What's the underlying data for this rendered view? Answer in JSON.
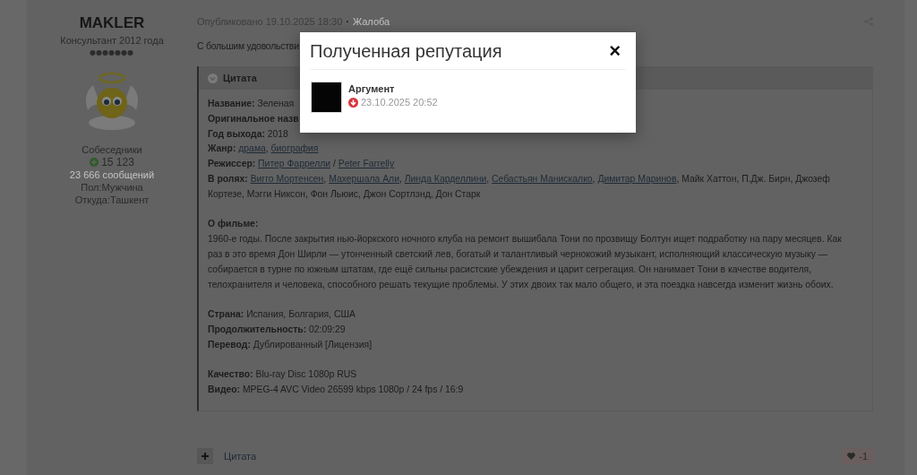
{
  "author": {
    "name": "MAKLER",
    "rank": "Консультант 2012 года",
    "group": "Собеседники",
    "reputation": "15 123",
    "posts": "23 666 сообщений",
    "gender": "Пол:Мужчина",
    "location": "Откуда:Ташкент"
  },
  "post": {
    "published": "Опубликовано 19.10.2025 18:30",
    "separator": "·",
    "report": "Жалоба",
    "intro": "С большим удовольстви",
    "quote": {
      "title": "Цитата",
      "sections": [
        [
          {
            "label": "Название:",
            "parts": [
              {
                "text": "Зеленая",
                "link": false
              }
            ]
          },
          {
            "label": "Оригинальное назв"
          },
          {
            "label": "Год выхода:",
            "parts": [
              {
                "text": "2018",
                "link": false
              }
            ]
          },
          {
            "label": "Жанр:",
            "parts": [
              {
                "text": "драма",
                "link": true
              },
              {
                "text": ", ",
                "link": false
              },
              {
                "text": "биография",
                "link": true
              }
            ]
          },
          {
            "label": "Режиссер:",
            "parts": [
              {
                "text": "Питер Фаррелли",
                "link": true
              },
              {
                "text": " / ",
                "link": false
              },
              {
                "text": "Peter Farrelly",
                "link": true
              }
            ]
          },
          {
            "label": "В ролях:",
            "parts": [
              {
                "text": "Вигго Мортенсен",
                "link": true
              },
              {
                "text": ", ",
                "link": false
              },
              {
                "text": "Махершала Али",
                "link": true
              },
              {
                "text": ", ",
                "link": false
              },
              {
                "text": "Линда Карделлини",
                "link": true
              },
              {
                "text": ", ",
                "link": false
              },
              {
                "text": "Себастьян Манискалко",
                "link": true
              },
              {
                "text": ", ",
                "link": false
              },
              {
                "text": "Димитар Маринов",
                "link": true
              },
              {
                "text": ", Майк Хаттон, П.Дж. Бирн, Джозеф Кортезе, Мэгги Никсон, Фон Льюис, Джон Сортлэнд, Дон Старк",
                "link": false
              }
            ]
          }
        ],
        [
          {
            "label": "О фильме:"
          },
          {
            "parts": [
              {
                "text": "1960-е годы. После закрытия нью-йоркского ночного клуба на ремонт вышибала Тони по прозвищу Болтун ищет подработку на пару месяцев. Как раз в это время Дон Ширли — утонченный светский лев, богатый и талантливый чернокожий музыкант, исполняющий классическую музыку — собирается в турне по южным штатам, где ещё сильны расистские убеждения и царит сегрегация. Он нанимает Тони в качестве водителя, телохранителя и человека, способного решать текущие проблемы. У этих двоих так мало общего, и эта поездка навсегда изменит жизнь обоих.",
                "link": false
              }
            ]
          }
        ],
        [
          {
            "label": "Страна:",
            "parts": [
              {
                "text": "Испания, Болгария, США",
                "link": false
              }
            ]
          },
          {
            "label": "Продолжительность:",
            "parts": [
              {
                "text": "02:09:29",
                "link": false
              }
            ]
          },
          {
            "label": "Перевод:",
            "parts": [
              {
                "text": "Дублированный [Лицензия]",
                "link": false
              }
            ]
          }
        ],
        [
          {
            "label": "Качество:",
            "parts": [
              {
                "text": "Blu-ray Disc 1080p RUS",
                "link": false
              }
            ]
          },
          {
            "label": "Видео:",
            "parts": [
              {
                "text": "MPEG-4 AVC Video 26599 kbps 1080p / 24 fps / 16:9",
                "link": false
              }
            ]
          }
        ]
      ]
    },
    "quote_action": "Цитата",
    "reaction_count": "-1"
  },
  "modal": {
    "title": "Полученная репутация",
    "close": "×",
    "items": [
      {
        "name": "Аргумент",
        "date": "23.10.2025 20:52"
      }
    ]
  }
}
